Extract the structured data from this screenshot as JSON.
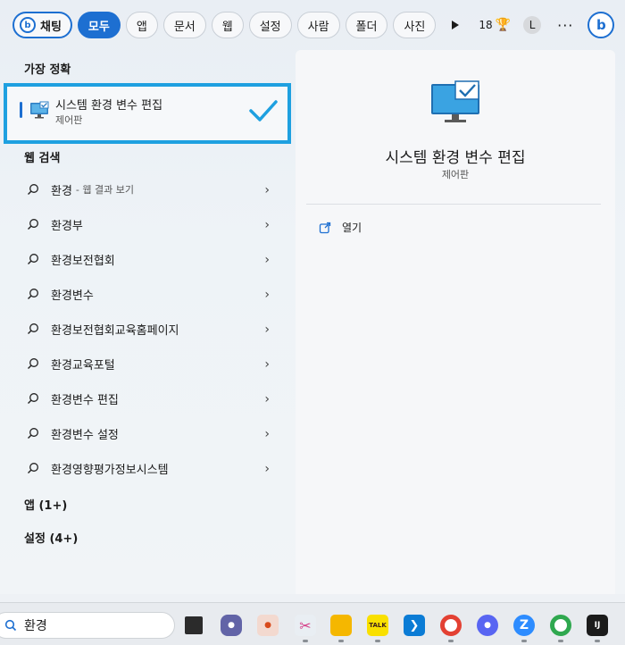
{
  "filters": {
    "chat": "채팅",
    "items": [
      "모두",
      "앱",
      "문서",
      "웹",
      "설정",
      "사람",
      "폴더",
      "사진"
    ],
    "active": "모두",
    "points": "18",
    "avatar": "L",
    "more": "···"
  },
  "left": {
    "best_match_title": "가장 정확",
    "best_match": {
      "name": "시스템 환경 변수 편집",
      "sub": "제어판"
    },
    "web_title": "웹 검색",
    "web_items": [
      {
        "text": "환경",
        "hint": "- 웹 결과 보기"
      },
      {
        "text": "환경부",
        "hint": ""
      },
      {
        "text": "환경보전협회",
        "hint": ""
      },
      {
        "text": "환경변수",
        "hint": ""
      },
      {
        "text": "환경보전협회교육홈페이지",
        "hint": ""
      },
      {
        "text": "환경교육포털",
        "hint": ""
      },
      {
        "text": "환경변수 편집",
        "hint": ""
      },
      {
        "text": "환경변수 설정",
        "hint": ""
      },
      {
        "text": "환경영향평가정보시스템",
        "hint": ""
      }
    ],
    "apps_title": "앱 (1+)",
    "settings_title": "설정 (4+)"
  },
  "detail": {
    "title": "시스템 환경 변수 편집",
    "sub": "제어판",
    "open_label": "열기"
  },
  "taskbar": {
    "query": "환경",
    "apps": [
      "task-view",
      "teams-chat",
      "photos",
      "snipping-tool",
      "file-explorer",
      "kakaotalk",
      "vscode",
      "chrome",
      "discord",
      "zoom",
      "chrome-profile",
      "intellij"
    ],
    "kakaotalk_label": "TALK",
    "intellij_label": "IJ"
  }
}
